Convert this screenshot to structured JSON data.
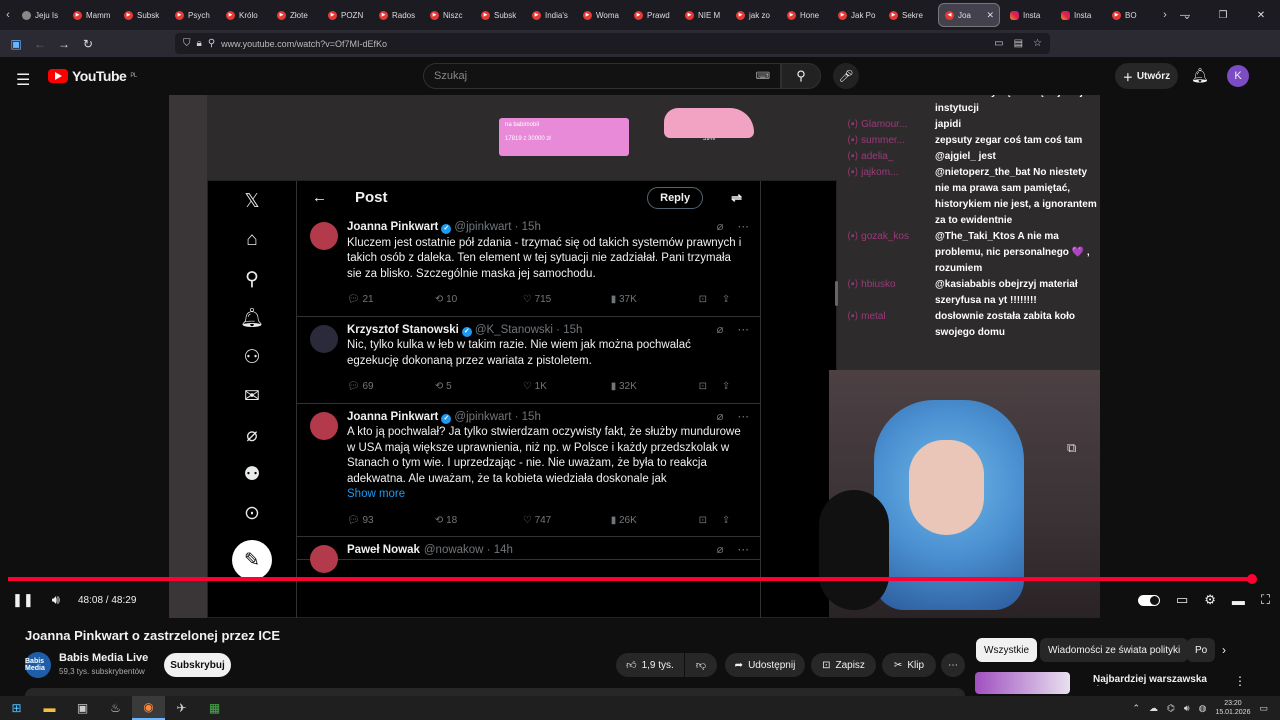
{
  "browser": {
    "tabs": [
      {
        "label": "Jeju Is",
        "icon": "globe"
      },
      {
        "label": "Mamm",
        "icon": "youtube"
      },
      {
        "label": "Subsk",
        "icon": "youtube"
      },
      {
        "label": "Psych",
        "icon": "youtube"
      },
      {
        "label": "Królo",
        "icon": "youtube"
      },
      {
        "label": "Złote",
        "icon": "youtube"
      },
      {
        "label": "POZN",
        "icon": "youtube"
      },
      {
        "label": "Rados",
        "icon": "youtube"
      },
      {
        "label": "Niszc",
        "icon": "youtube"
      },
      {
        "label": "Subsk",
        "icon": "youtube"
      },
      {
        "label": "India's",
        "icon": "youtube"
      },
      {
        "label": "Woma",
        "icon": "youtube"
      },
      {
        "label": "Prawd",
        "icon": "youtube"
      },
      {
        "label": "NIE M",
        "icon": "youtube"
      },
      {
        "label": "jak zo",
        "icon": "youtube"
      },
      {
        "label": "Hone",
        "icon": "youtube"
      },
      {
        "label": "Jak Po",
        "icon": "youtube"
      },
      {
        "label": "Sekre",
        "icon": "youtube"
      }
    ],
    "active_tab": {
      "label": "Joa",
      "icon": "youtube"
    },
    "after_tabs": [
      {
        "label": "Insta",
        "icon": "instagram"
      },
      {
        "label": "Insta",
        "icon": "instagram"
      },
      {
        "label": "BO",
        "icon": "youtube"
      }
    ],
    "url": "www.youtube.com/watch?v=Of7MI-dEfKo",
    "ext_badge": "469"
  },
  "youtube": {
    "logo_text": "YouTube",
    "region": "PL",
    "search_placeholder": "Szukaj",
    "create_label": "Utwórz",
    "avatar_letter": "K"
  },
  "video_overlay": {
    "donation_label": "na babimobil",
    "donation_progress": "17819 z 30000 zł",
    "donation_percent": "59%",
    "twitter": {
      "header": "Post",
      "reply_label": "Reply",
      "tweets": [
        {
          "name": "Joanna Pinkwart",
          "handle": "@jpinkwart · 15h",
          "text": "Kluczem jest ostatnie pół zdania - trzymać się od takich systemów prawnych i takich osób z daleka. Ten element w tej sytuacji nie zadziałał. Pani trzymała sie za blisko. Szczególnie maska jej samochodu.",
          "more": "",
          "replies": "21",
          "reposts": "10",
          "likes": "715",
          "views": "37K"
        },
        {
          "name": "Krzysztof Stanowski",
          "handle": "@K_Stanowski · 15h",
          "text": "Nic, tylko kulka w łeb w takim razie. Nie wiem jak można pochwalać egzekucję dokonaną przez wariata z pistoletem.",
          "more": "",
          "replies": "69",
          "reposts": "5",
          "likes": "1K",
          "views": "32K"
        },
        {
          "name": "Joanna Pinkwart",
          "handle": "@jpinkwart · 15h",
          "text": "A kto ją pochwalał? Ja tylko stwierdzam oczywisty fakt, że służby mundurowe w USA mają większe uprawnienia, niż np. w Polsce i każdy przedszkolak w Stanach o tym wie. I uprzedzając - nie. Nie uważam, że była to reakcja adekwatna. Ale uważam, że ta kobieta wiedziała doskonale jak",
          "more": "Show more",
          "replies": "93",
          "reposts": "18",
          "likes": "747",
          "views": "26K"
        },
        {
          "name": "Paweł Nowak",
          "handle": "@nowakow · 14h",
          "text": "",
          "more": "",
          "replies": "",
          "reposts": "",
          "likes": "",
          "views": ""
        }
      ]
    },
    "chat": [
      {
        "user": "",
        "text": "chodzi o zwykłą służbę w jakiejś instytucji"
      },
      {
        "user": "Glamour...",
        "text": "japidi"
      },
      {
        "user": "summer...",
        "text": "zepsuty zegar coś tam coś tam"
      },
      {
        "user": "adelia_",
        "text": "@ajgiel_ jest"
      },
      {
        "user": "jajkom...",
        "text": "@nietoperz_the_bat No niestety nie ma prawa sam pamiętać, historykiem nie jest, a ignorantem za to ewidentnie"
      },
      {
        "user": "gozak_kos",
        "text": "@The_Taki_Ktos A nie ma problemu, nic personalnego 💜 , rozumiem"
      },
      {
        "user": "hbiusko",
        "text": "@kasiababis obejrzyj materiał szeryfusa na yt !!!!!!!!"
      },
      {
        "user": "metal",
        "text": "dosłownie została zabita koło swojego domu"
      }
    ]
  },
  "player": {
    "time": "48:08 / 48:29",
    "progress_fraction": 0.993
  },
  "video_info": {
    "title": "Joanna Pinkwart o zastrzelonej przez ICE",
    "channel": "Babis Media Live",
    "channel_avatar_text": "Babis Media",
    "subscribers": "59,3 tys. subskrybentów",
    "subscribe_label": "Subskrybuj",
    "likes": "1,9 tys.",
    "share_label": "Udostępnij",
    "save_label": "Zapisz",
    "clip_label": "Klip"
  },
  "sidebar": {
    "chips": [
      "Wszystkie",
      "Wiadomości ze świata polityki",
      "Po"
    ],
    "rec_title": "Najbardziej warszawska drama EVER"
  },
  "taskbar": {
    "time": "23:20",
    "date": "15.01.2026"
  }
}
